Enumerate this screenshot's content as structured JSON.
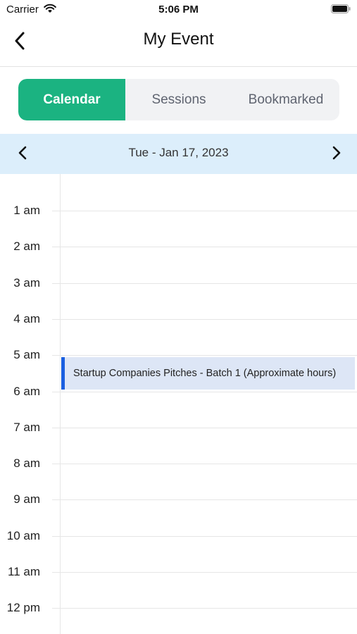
{
  "status_bar": {
    "carrier": "Carrier",
    "time": "5:06 PM"
  },
  "nav": {
    "title": "My Event",
    "back_icon": "chevron-left-icon"
  },
  "tabs": [
    {
      "label": "Calendar",
      "active": true
    },
    {
      "label": "Sessions",
      "active": false
    },
    {
      "label": "Bookmarked",
      "active": false
    }
  ],
  "date_bar": {
    "label": "Tue - Jan 17, 2023",
    "prev_icon": "chevron-left-icon",
    "next_icon": "chevron-right-icon"
  },
  "calendar": {
    "hours": [
      "1 am",
      "2 am",
      "3 am",
      "4 am",
      "5 am",
      "6 am",
      "7 am",
      "8 am",
      "9 am",
      "10 am",
      "11 am",
      "12 pm"
    ],
    "events": [
      {
        "title": "Startup Companies Pitches - Batch 1 (Approximate hours)",
        "start_hour": 5.0,
        "end_hour": 5.9
      }
    ]
  },
  "colors": {
    "accent_green": "#1bb381",
    "date_bar_bg": "#dceefb",
    "event_bg": "#dde6f6",
    "event_border": "#1a5fe0"
  }
}
